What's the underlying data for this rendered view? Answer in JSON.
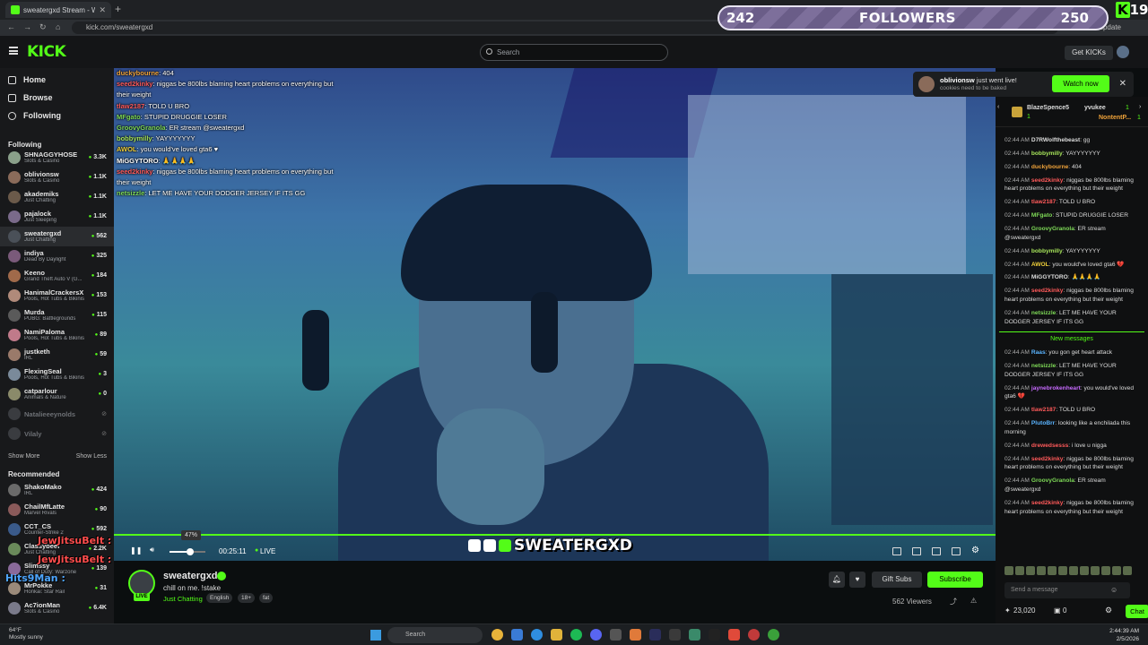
{
  "browser": {
    "tab_title": "sweatergxd Stream - Watch...",
    "url": "kick.com/sweatergxd",
    "update_label": "to update"
  },
  "header": {
    "logo": "KICK",
    "search_placeholder": "Search",
    "get_kicks": "Get KICKs"
  },
  "overlay": {
    "followers_current": "242",
    "followers_label": "FOLLOWERS",
    "followers_goal": "250",
    "corner_count": "19"
  },
  "sidebar": {
    "nav": [
      "Home",
      "Browse",
      "Following"
    ],
    "following_title": "Following",
    "following": [
      {
        "name": "SHNAGGYHOSE",
        "cat": "Slots & Casino",
        "viewers": "3.3K",
        "color": "#8aa08a"
      },
      {
        "name": "oblivionsw",
        "cat": "Slots & Casino",
        "viewers": "1.1K",
        "color": "#8a6b5a"
      },
      {
        "name": "akademiks",
        "cat": "Just Chatting",
        "viewers": "1.1K",
        "color": "#6b5a4a"
      },
      {
        "name": "pajalock",
        "cat": "Just Sleeping",
        "viewers": "1.1K",
        "color": "#7a6a8a"
      },
      {
        "name": "sweatergxd",
        "cat": "Just Chatting",
        "viewers": "562",
        "color": "#4a5058"
      },
      {
        "name": "indiya",
        "cat": "Dead By Daylight",
        "viewers": "325",
        "color": "#7a5a7a"
      },
      {
        "name": "Keeno",
        "cat": "Grand Theft Auto V (G...",
        "viewers": "184",
        "color": "#a06a4a"
      },
      {
        "name": "HanimalCrackersX",
        "cat": "Pools, Hot Tubs & Bikinis",
        "viewers": "153",
        "color": "#b08a7a"
      },
      {
        "name": "Murda",
        "cat": "PUBG: Battlegrounds",
        "viewers": "115",
        "color": "#5a5a5a"
      },
      {
        "name": "NamiPaloma",
        "cat": "Pools, Hot Tubs & Bikinis",
        "viewers": "89",
        "color": "#c07a8a"
      },
      {
        "name": "justketh",
        "cat": "IRL",
        "viewers": "59",
        "color": "#9a7a6a"
      },
      {
        "name": "FlexingSeal",
        "cat": "Pools, Hot Tubs & Bikinis",
        "viewers": "3",
        "color": "#7a8a9a"
      },
      {
        "name": "catparlour",
        "cat": "Animals & Nature",
        "viewers": "0",
        "color": "#8a8a6a"
      }
    ],
    "offline": [
      "Natalieeeynolds",
      "Vilaly"
    ],
    "show_more": "Show More",
    "show_less": "Show Less",
    "recommended_title": "Recommended",
    "recommended": [
      {
        "name": "ShakoMako",
        "cat": "IRL",
        "viewers": "424",
        "color": "#6a6a6a"
      },
      {
        "name": "ChailMfLatte",
        "cat": "Marvel Rivals",
        "viewers": "90",
        "color": "#8a5a5a"
      },
      {
        "name": "CCT_CS",
        "cat": "Counter-Strike 2",
        "viewers": "592",
        "color": "#3a5a8a"
      },
      {
        "name": "Classybeef",
        "cat": "Just Chatting",
        "viewers": "2.2K",
        "color": "#6a8a5a"
      },
      {
        "name": "Slimssy",
        "cat": "Call of Duty: Warzone",
        "viewers": "139",
        "color": "#8a6a9a"
      },
      {
        "name": "MrPokke",
        "cat": "Honkai: Star Rail",
        "viewers": "31",
        "color": "#9a8a7a"
      },
      {
        "name": "Ac7ionMan",
        "cat": "Slots & Casino",
        "viewers": "6.4K",
        "color": "#7a7a8a"
      }
    ]
  },
  "stream_overlay_chat": [
    {
      "user": "duckybourne",
      "color": "#f0a33a",
      "msg": "404"
    },
    {
      "user": "seed2kinky",
      "color": "#ff5a5a",
      "msg": "niggas be 800lbs blaming heart problems on everything but their weight"
    },
    {
      "user": "tlaw2187",
      "color": "#ff5a5a",
      "msg": "TOLD U BRO"
    },
    {
      "user": "MFgato",
      "color": "#7ed957",
      "msg": "STUPID DRUGGIE LOSER"
    },
    {
      "user": "GroovyGranola",
      "color": "#7ed957",
      "msg": "ER stream @sweatergxd"
    },
    {
      "user": "bobbymilly",
      "color": "#a6e35a",
      "msg": "YAYYYYYYY"
    },
    {
      "user": "AWOL",
      "color": "#f0d03a",
      "msg": "you would've loved gta6 ♥"
    },
    {
      "user": "MiGGYTORO",
      "color": "#ffffff",
      "msg": "🙏🙏🙏🙏"
    },
    {
      "user": "seed2kinky",
      "color": "#ff5a5a",
      "msg": "niggas be 800lbs blaming heart problems on everything but their weight"
    },
    {
      "user": "netsizzle",
      "color": "#7ed957",
      "msg": "LET ME HAVE YOUR DODGER JERSEY IF ITS GG"
    }
  ],
  "video": {
    "watermark": "SWEATERGXD",
    "time": "00:25:11",
    "live": "LIVE",
    "volume_tip": "47%",
    "volume_level": 0.47
  },
  "overlay_names": {
    "jj": "JewJitsuBelt :",
    "hits": "Hits9Man :"
  },
  "streamer": {
    "name": "sweatergxd",
    "title": "chill on me. !stake",
    "category": "Just Chatting",
    "tags": [
      "English",
      "18+",
      "fat"
    ],
    "gift_subs": "Gift Subs",
    "subscribe": "Subscribe",
    "viewers": "562 Viewers"
  },
  "notification": {
    "user": "oblivionsw",
    "text": "just went live!",
    "subtitle": "cookies need to be baked",
    "watch_now": "Watch now"
  },
  "chat": {
    "gifters": [
      {
        "name": "BlazeSpence5",
        "count": "1"
      },
      {
        "name": "yvukee",
        "count": "1"
      },
      {
        "name": "NontentP...",
        "count": "1"
      }
    ],
    "messages": [
      {
        "time": "02:44 AM",
        "user": "D7RWolfthebeast",
        "color": "#dcdcdc",
        "msg": "gg"
      },
      {
        "time": "02:44 AM",
        "user": "bobbymilly",
        "color": "#a6e35a",
        "msg": "YAYYYYYYY"
      },
      {
        "time": "02:44 AM",
        "user": "duckybourne",
        "color": "#f0a33a",
        "msg": "404"
      },
      {
        "time": "02:44 AM",
        "user": "seed2kinky",
        "color": "#ff5a5a",
        "msg": "niggas be 800lbs blaming heart problems on everything but their weight"
      },
      {
        "time": "02:44 AM",
        "user": "tlaw2187",
        "color": "#ff5a5a",
        "msg": "TOLD U BRO"
      },
      {
        "time": "02:44 AM",
        "user": "MFgato",
        "color": "#7ed957",
        "msg": "STUPID DRUGGIE LOSER"
      },
      {
        "time": "02:44 AM",
        "user": "GroovyGranola",
        "color": "#7ed957",
        "msg": "ER stream @sweatergxd"
      },
      {
        "time": "02:44 AM",
        "user": "bobbymilly",
        "color": "#a6e35a",
        "msg": "YAYYYYYYY"
      },
      {
        "time": "02:44 AM",
        "user": "AWOL",
        "color": "#f0d03a",
        "msg": "you would've loved gta6 💔"
      },
      {
        "time": "02:44 AM",
        "user": "MiGGYTORO",
        "color": "#dcdcdc",
        "msg": "🙏🙏🙏🙏"
      },
      {
        "time": "02:44 AM",
        "user": "seed2kinky",
        "color": "#ff5a5a",
        "msg": "niggas be 800lbs blaming heart problems on everything but their weight"
      },
      {
        "time": "02:44 AM",
        "user": "netsizzle",
        "color": "#7ed957",
        "msg": "LET ME HAVE YOUR DODGER JERSEY IF ITS GG"
      }
    ],
    "new_messages_label": "New messages",
    "new_messages": [
      {
        "time": "02:44 AM",
        "user": "Raas",
        "color": "#5ab4ff",
        "msg": "you gon get heart attack"
      },
      {
        "time": "02:44 AM",
        "user": "netsizzle",
        "color": "#7ed957",
        "msg": "LET ME HAVE YOUR DODGER JERSEY IF ITS GG"
      },
      {
        "time": "02:44 AM",
        "user": "jaynebrokenheart",
        "color": "#c86bff",
        "msg": "you would've loved gta6 💔"
      },
      {
        "time": "02:44 AM",
        "user": "tlaw2187",
        "color": "#ff5a5a",
        "msg": "TOLD U BRO"
      },
      {
        "time": "02:44 AM",
        "user": "PlutoBrr",
        "color": "#5ab4ff",
        "msg": "looking like a enchilada this morning"
      },
      {
        "time": "02:44 AM",
        "user": "drewedsesss",
        "color": "#ff5a5a",
        "msg": "i love u nigga"
      },
      {
        "time": "02:44 AM",
        "user": "seed2kinky",
        "color": "#ff5a5a",
        "msg": "niggas be 800lbs blaming heart problems on everything but their weight"
      },
      {
        "time": "02:44 AM",
        "user": "GroovyGranola",
        "color": "#7ed957",
        "msg": "ER stream @sweatergxd"
      },
      {
        "time": "02:44 AM",
        "user": "seed2kinky",
        "color": "#ff5a5a",
        "msg": "niggas be 800lbs blaming heart problems on everything but their weight"
      }
    ],
    "input_placeholder": "Send a message",
    "kicks_balance": "23,020",
    "other_count": "0",
    "chat_button": "Chat"
  },
  "taskbar": {
    "temp": "64°F",
    "weather": "Mostly sunny",
    "search": "Search",
    "time": "2:44:39 AM",
    "date": "2/5/2026"
  },
  "colors": {
    "accent": "#53fc18",
    "bg": "#0b0e0f",
    "sidebar": "#18191b"
  }
}
